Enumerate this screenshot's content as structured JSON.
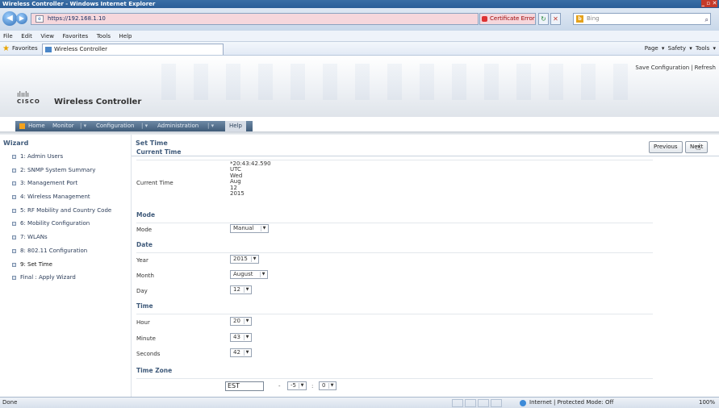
{
  "window": {
    "title": "Wireless Controller - Windows Internet Explorer",
    "controls": "_ ▫ ✕"
  },
  "browser": {
    "url": "https://192.168.1.10",
    "cert_error": "Certificate Error",
    "search_placeholder": "Bing",
    "menu": [
      "File",
      "Edit",
      "View",
      "Favorites",
      "Tools",
      "Help"
    ],
    "favorites_label": "Favorites",
    "tab_title": "Wireless Controller",
    "command_bar": "Page ▾  Safety ▾  Tools ▾"
  },
  "header": {
    "brand_bars": "ılıılı",
    "brand_word": "CISCO",
    "product": "Wireless Controller",
    "save_config": "Save Configuration",
    "separator": "|",
    "refresh": "Refresh",
    "nav": {
      "home": "Home",
      "monitor": "Monitor",
      "configuration": "Configuration",
      "administration": "Administration",
      "help": "Help",
      "separator": "|  ▾"
    }
  },
  "wizard": {
    "title": "Wizard",
    "items": [
      {
        "label": "1: Admin Users"
      },
      {
        "label": "2: SNMP System Summary"
      },
      {
        "label": "3: Management Port"
      },
      {
        "label": "4: Wireless Management"
      },
      {
        "label": "5: RF Mobility and Country Code"
      },
      {
        "label": "6: Mobility Configuration"
      },
      {
        "label": "7: WLANs"
      },
      {
        "label": "8: 802.11 Configuration"
      },
      {
        "label": "9: Set Time"
      },
      {
        "label": "Final : Apply Wizard"
      }
    ]
  },
  "page": {
    "title": "Set Time",
    "previous": "Previous",
    "next": "Next",
    "current_time_section": "Current Time",
    "current_time_label": "Current Time",
    "current_time_lines": [
      "*20:43:42.590",
      "UTC",
      "Wed",
      "Aug",
      "12",
      "2015"
    ],
    "mode_section": "Mode",
    "mode_label": "Mode",
    "mode_value": "Manual",
    "date_section": "Date",
    "year_label": "Year",
    "year_value": "2015",
    "month_label": "Month",
    "month_value": "August",
    "day_label": "Day",
    "day_value": "12",
    "time_section": "Time",
    "hour_label": "Hour",
    "hour_value": "20",
    "minute_label": "Minute",
    "minute_value": "43",
    "seconds_label": "Seconds",
    "seconds_value": "42",
    "timezone_section": "Time Zone",
    "tz_name": "EST",
    "tz_dash": "-",
    "tz_offset_hours": "-5",
    "tz_colon": ":",
    "tz_offset_minutes": "0",
    "dropdown_arrow": "▼"
  },
  "status": {
    "done": "Done",
    "zone": "Internet | Protected Mode: Off",
    "zoom": "100%"
  }
}
